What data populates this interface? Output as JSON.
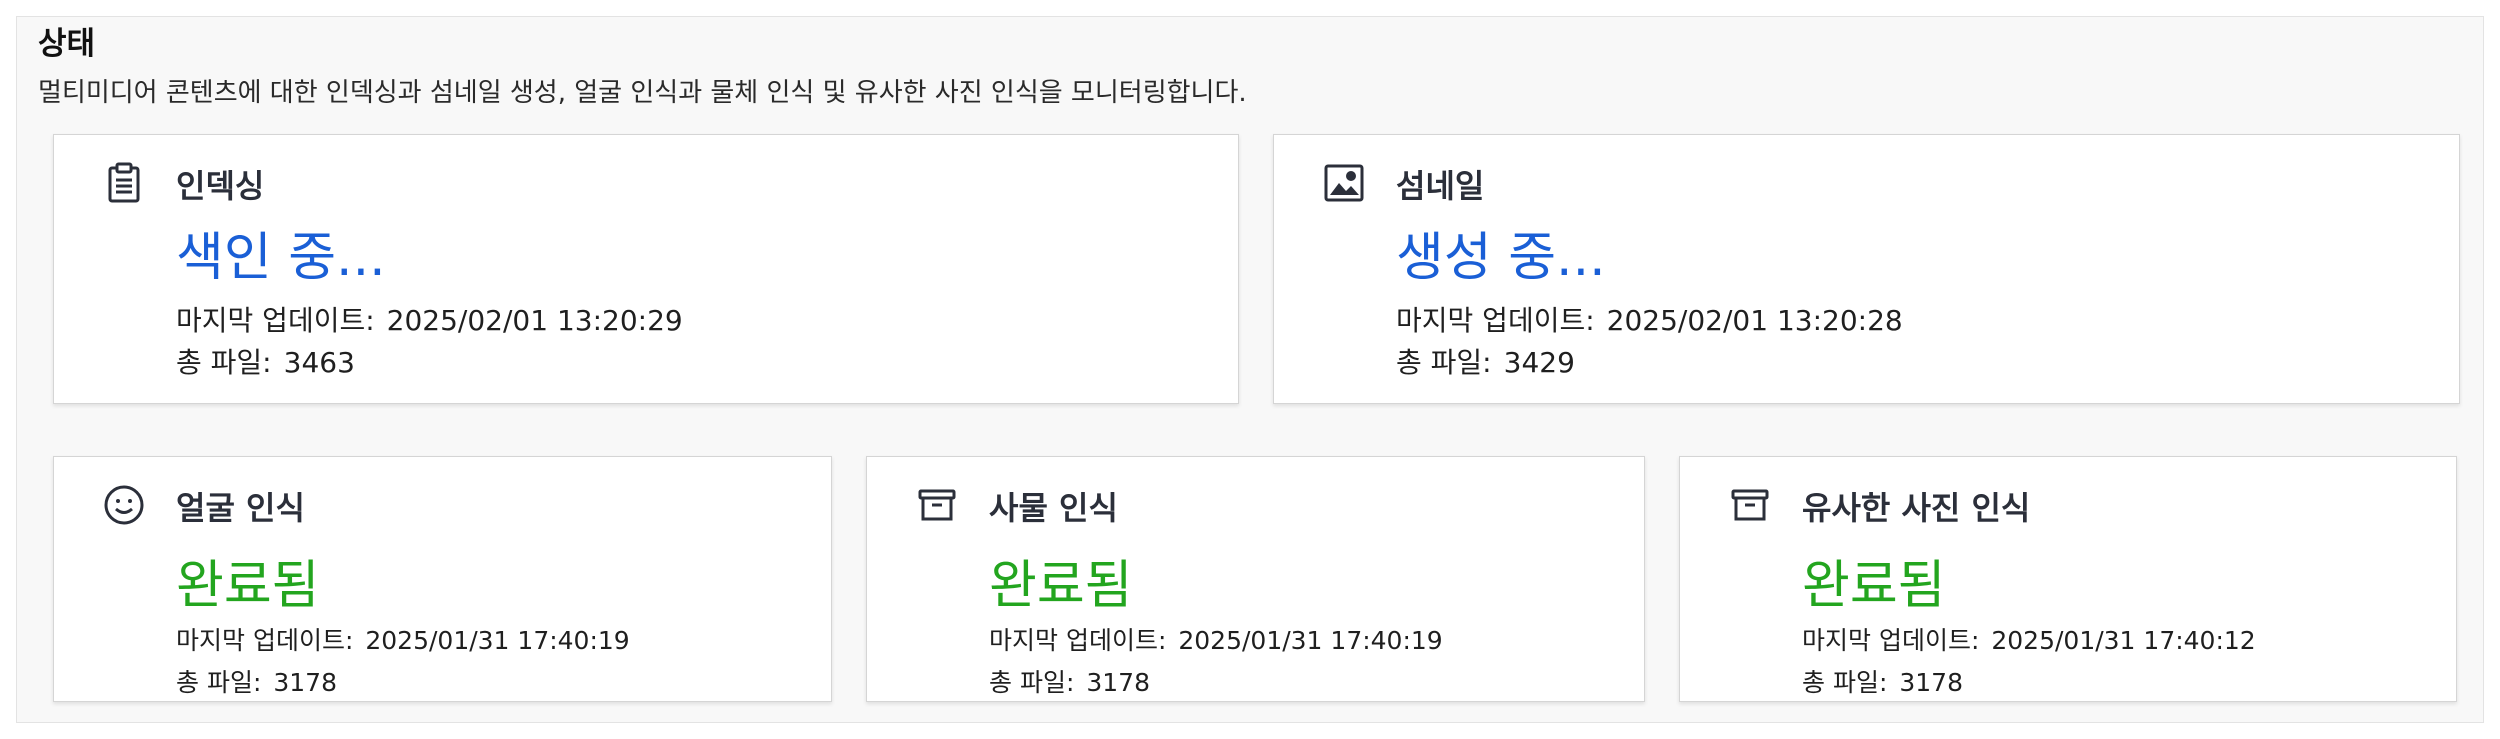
{
  "header": {
    "title": "상태",
    "description": "멀티미디어 콘텐츠에 대한 인덱싱과 섬네일 생성, 얼굴 인식과 물체 인식 및 유사한 사진 인식을 모니터링합니다."
  },
  "labels": {
    "last_update": "마지막 업데이트:",
    "total_files": "총 파일:"
  },
  "cards": [
    {
      "name": "인덱싱",
      "status": "색인 중...",
      "last_update": "2025/02/01 13:20:29",
      "total_files": "3463",
      "icon": "clipboard-icon",
      "status_color": "#1a5fd6"
    },
    {
      "name": "섬네일",
      "status": "생성 중...",
      "last_update": "2025/02/01 13:20:28",
      "total_files": "3429",
      "icon": "image-icon",
      "status_color": "#1a5fd6"
    },
    {
      "name": "얼굴 인식",
      "status": "완료됨",
      "last_update": "2025/01/31 17:40:19",
      "total_files": "3178",
      "icon": "smiley-face-icon",
      "status_color": "#23a51f"
    },
    {
      "name": "사물 인식",
      "status": "완료됨",
      "last_update": "2025/01/31 17:40:19",
      "total_files": "3178",
      "icon": "archive-box-icon",
      "status_color": "#23a51f"
    },
    {
      "name": "유사한 사진 인식",
      "status": "완료됨",
      "last_update": "2025/01/31 17:40:12",
      "total_files": "3178",
      "icon": "archive-box-icon",
      "status_color": "#23a51f"
    }
  ]
}
